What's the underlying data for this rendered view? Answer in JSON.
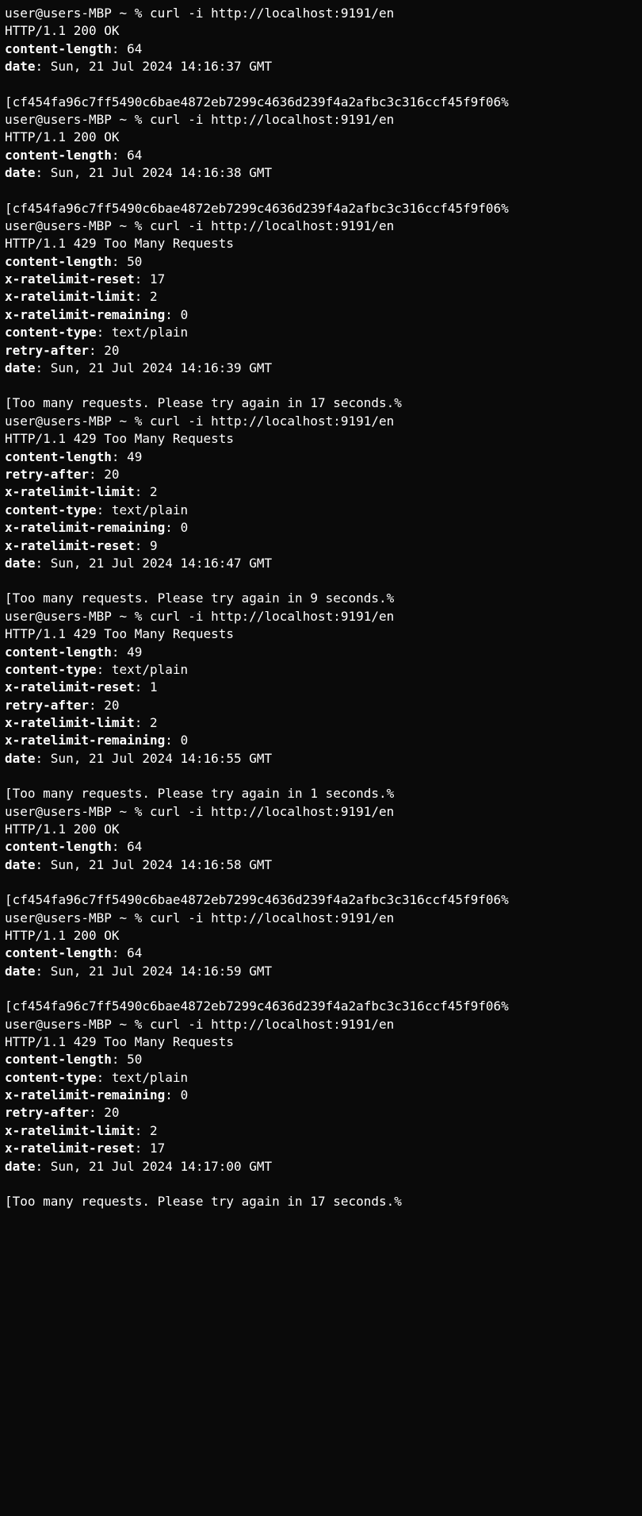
{
  "prompt": "user@users-MBP ~ % ",
  "command": "curl -i http://localhost:9191/en",
  "hash": "cf454fa96c7ff5490c6bae4872eb7299c4636d239f4a2afbc3c316ccf45f9f06",
  "blocks": [
    {
      "status": "HTTP/1.1 200 OK",
      "headers": [
        {
          "name": "content-length",
          "value": "64"
        },
        {
          "name": "date",
          "value": "Sun, 21 Jul 2024 14:16:37 GMT"
        }
      ],
      "body_is_hash": true,
      "body": ""
    },
    {
      "status": "HTTP/1.1 200 OK",
      "headers": [
        {
          "name": "content-length",
          "value": "64"
        },
        {
          "name": "date",
          "value": "Sun, 21 Jul 2024 14:16:38 GMT"
        }
      ],
      "body_is_hash": true,
      "body": ""
    },
    {
      "status": "HTTP/1.1 429 Too Many Requests",
      "headers": [
        {
          "name": "content-length",
          "value": "50"
        },
        {
          "name": "x-ratelimit-reset",
          "value": "17"
        },
        {
          "name": "x-ratelimit-limit",
          "value": "2"
        },
        {
          "name": "x-ratelimit-remaining",
          "value": "0"
        },
        {
          "name": "content-type",
          "value": "text/plain"
        },
        {
          "name": "retry-after",
          "value": "20"
        },
        {
          "name": "date",
          "value": "Sun, 21 Jul 2024 14:16:39 GMT"
        }
      ],
      "body_is_hash": false,
      "body": "Too many requests. Please try again in 17 seconds."
    },
    {
      "status": "HTTP/1.1 429 Too Many Requests",
      "headers": [
        {
          "name": "content-length",
          "value": "49"
        },
        {
          "name": "retry-after",
          "value": "20"
        },
        {
          "name": "x-ratelimit-limit",
          "value": "2"
        },
        {
          "name": "content-type",
          "value": "text/plain"
        },
        {
          "name": "x-ratelimit-remaining",
          "value": "0"
        },
        {
          "name": "x-ratelimit-reset",
          "value": "9"
        },
        {
          "name": "date",
          "value": "Sun, 21 Jul 2024 14:16:47 GMT"
        }
      ],
      "body_is_hash": false,
      "body": "Too many requests. Please try again in 9 seconds."
    },
    {
      "status": "HTTP/1.1 429 Too Many Requests",
      "headers": [
        {
          "name": "content-length",
          "value": "49"
        },
        {
          "name": "content-type",
          "value": "text/plain"
        },
        {
          "name": "x-ratelimit-reset",
          "value": "1"
        },
        {
          "name": "retry-after",
          "value": "20"
        },
        {
          "name": "x-ratelimit-limit",
          "value": "2"
        },
        {
          "name": "x-ratelimit-remaining",
          "value": "0"
        },
        {
          "name": "date",
          "value": "Sun, 21 Jul 2024 14:16:55 GMT"
        }
      ],
      "body_is_hash": false,
      "body": "Too many requests. Please try again in 1 seconds."
    },
    {
      "status": "HTTP/1.1 200 OK",
      "headers": [
        {
          "name": "content-length",
          "value": "64"
        },
        {
          "name": "date",
          "value": "Sun, 21 Jul 2024 14:16:58 GMT"
        }
      ],
      "body_is_hash": true,
      "body": ""
    },
    {
      "status": "HTTP/1.1 200 OK",
      "headers": [
        {
          "name": "content-length",
          "value": "64"
        },
        {
          "name": "date",
          "value": "Sun, 21 Jul 2024 14:16:59 GMT"
        }
      ],
      "body_is_hash": true,
      "body": ""
    },
    {
      "status": "HTTP/1.1 429 Too Many Requests",
      "headers": [
        {
          "name": "content-length",
          "value": "50"
        },
        {
          "name": "content-type",
          "value": "text/plain"
        },
        {
          "name": "x-ratelimit-remaining",
          "value": "0"
        },
        {
          "name": "retry-after",
          "value": "20"
        },
        {
          "name": "x-ratelimit-limit",
          "value": "2"
        },
        {
          "name": "x-ratelimit-reset",
          "value": "17"
        },
        {
          "name": "date",
          "value": "Sun, 21 Jul 2024 14:17:00 GMT"
        }
      ],
      "body_is_hash": false,
      "body": "Too many requests. Please try again in 17 seconds.",
      "last": true
    }
  ]
}
